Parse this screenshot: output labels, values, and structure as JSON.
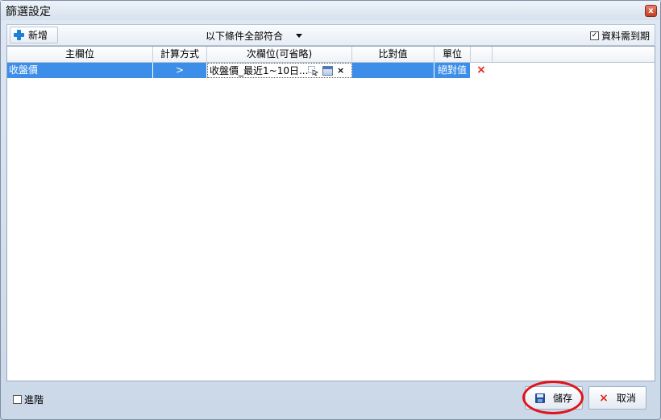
{
  "window": {
    "title": "篩選設定",
    "close_label": "x"
  },
  "toolbar": {
    "add_label": "新增",
    "match_mode": "以下條件全部符合",
    "expire_label": "資料需到期",
    "expire_checked": "✓"
  },
  "grid": {
    "columns": [
      "主欄位",
      "計算方式",
      "次欄位(可省略)",
      "比對值",
      "單位",
      ""
    ],
    "rows": [
      {
        "main": "收盤價",
        "calc": ">",
        "sub": "收盤價_最近1~10日...",
        "compare": "",
        "unit": "絕對值",
        "delete": "×"
      }
    ]
  },
  "footer": {
    "advanced_label": "進階",
    "save_label": "儲存",
    "cancel_label": "取消"
  },
  "colors": {
    "selection": "#3d8ee8",
    "delete_red": "#e0261b",
    "highlight_red": "#e0141b"
  }
}
